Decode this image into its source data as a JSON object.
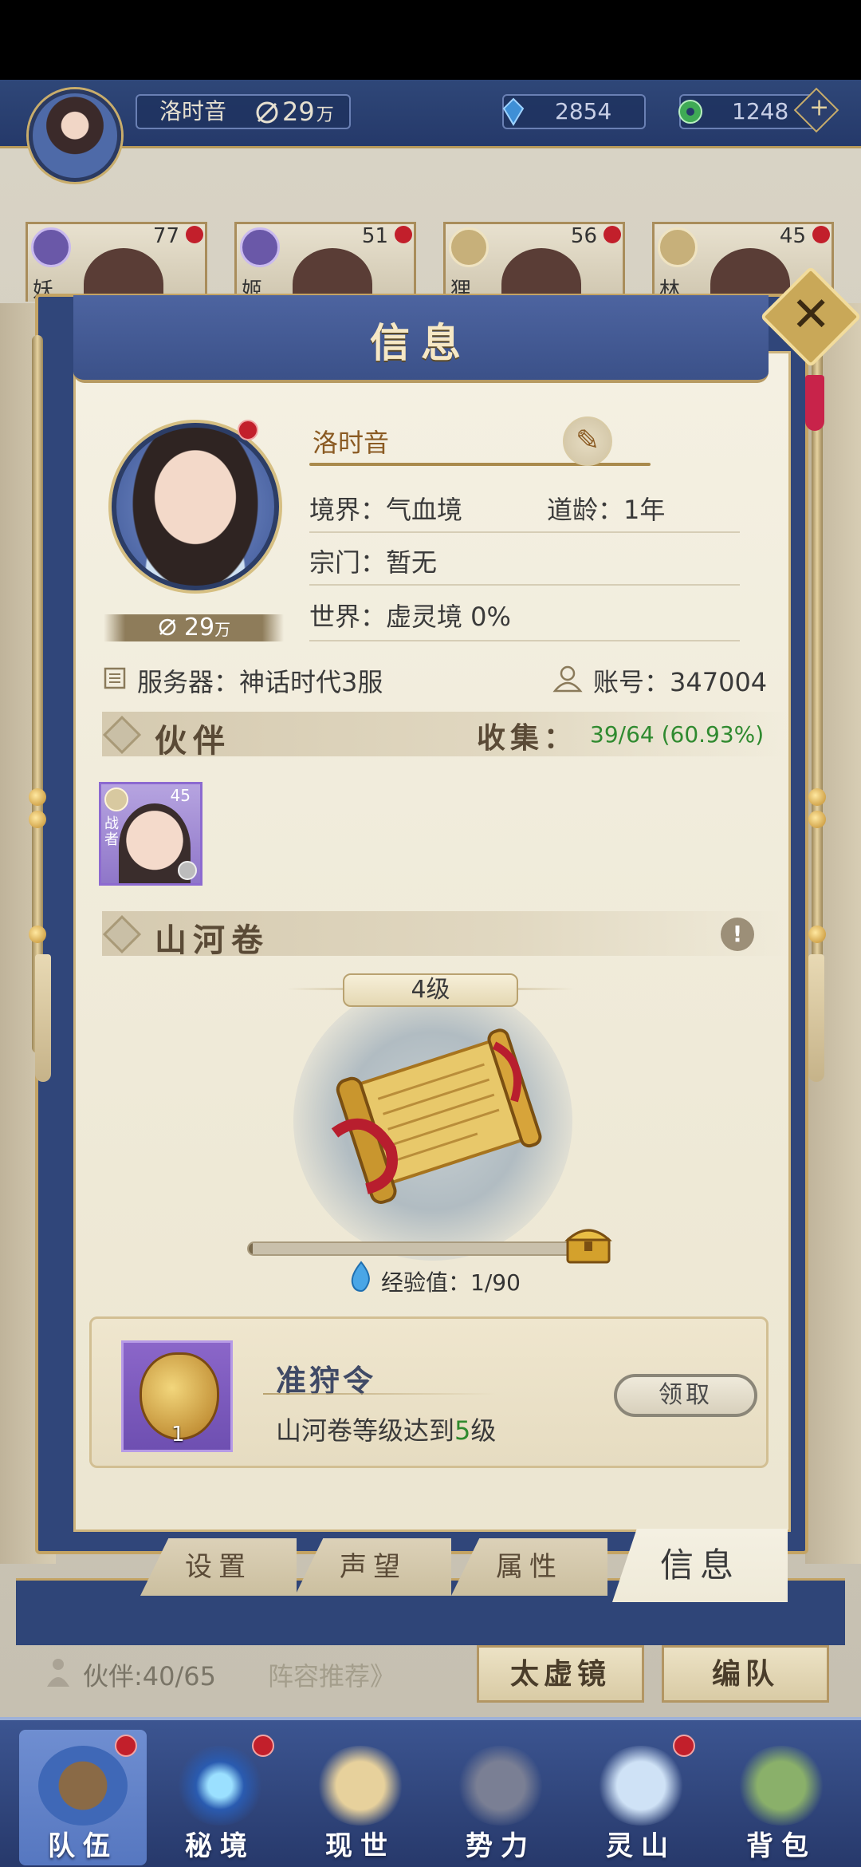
{
  "topbar": {
    "player_name": "洛时音",
    "power": "29",
    "power_unit": "万",
    "currency_gem": "2854",
    "currency_jade": "1248",
    "plus": "+"
  },
  "hero_cards": [
    {
      "level": "77",
      "name": "妖"
    },
    {
      "level": "51",
      "name": "姬"
    },
    {
      "level": "56",
      "name": "狸"
    },
    {
      "level": "45",
      "name": "林"
    }
  ],
  "modal": {
    "title": "信息",
    "close": "✕",
    "profile": {
      "name": "洛时音",
      "power": "29",
      "power_unit": "万",
      "realm": "境界：气血境",
      "dao_age": "道龄：1年",
      "sect": "宗门：暂无",
      "world": "世界：虚灵境  0%",
      "server": "服务器：神话时代3服",
      "account": "账号：347004",
      "edit_icon": "✎"
    },
    "companions": {
      "title": "伙伴",
      "collect_label": "收集：",
      "collect_value": "39/64 (60.93%)",
      "card": {
        "level": "45",
        "role": "战者"
      }
    },
    "scroll": {
      "title": "山河卷",
      "info": "!",
      "level": "4级",
      "exp_label": "经验值：1/90",
      "exp_fraction": 0.011
    },
    "reward": {
      "title": "准狩令",
      "count": "1",
      "desc_prefix": "山河卷等级达到",
      "desc_level": "5",
      "desc_suffix": "级",
      "claim": "领取"
    },
    "tabs": [
      {
        "label": "设置"
      },
      {
        "label": "声望"
      },
      {
        "label": "属性"
      },
      {
        "label": "信息"
      }
    ]
  },
  "below": {
    "partner_count": "伙伴:40/65",
    "lineup_recommend": "阵容推荐》",
    "taixu_button": "太虚镜",
    "formation_button": "编队"
  },
  "bottom_nav": [
    {
      "label": "队伍"
    },
    {
      "label": "秘境"
    },
    {
      "label": "现世"
    },
    {
      "label": "势力"
    },
    {
      "label": "灵山"
    },
    {
      "label": "背包"
    }
  ],
  "colors": {
    "accent_blue": "#30467a",
    "gold": "#c4a464",
    "green": "#2f8a2f",
    "red_dot": "#c21f2b"
  }
}
